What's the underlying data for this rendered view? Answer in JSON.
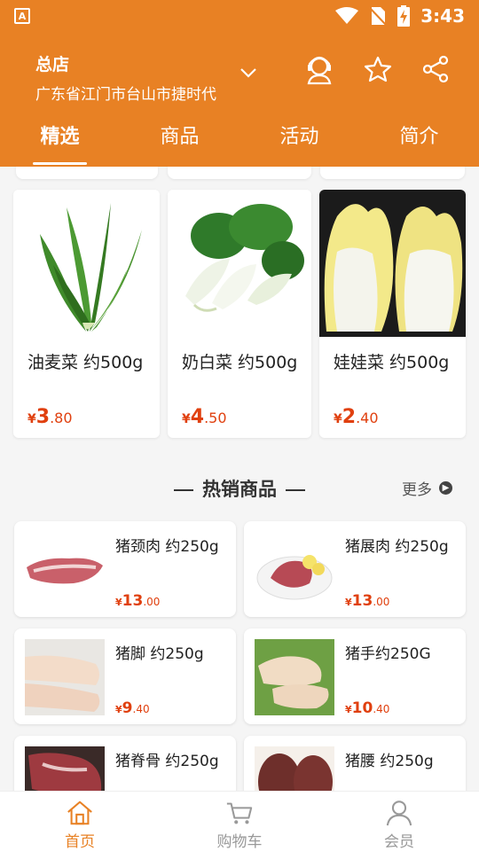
{
  "status_bar": {
    "time": "3:43",
    "left_icon": "A"
  },
  "header": {
    "store_name": "总店",
    "address": "广东省江门市台山市捷时代",
    "icons": [
      "chevron-down-icon",
      "customer-service-icon",
      "star-icon",
      "share-icon"
    ]
  },
  "tabs": [
    {
      "label": "精选",
      "active": true
    },
    {
      "label": "商品",
      "active": false
    },
    {
      "label": "活动",
      "active": false
    },
    {
      "label": "简介",
      "active": false
    }
  ],
  "veg_cards": [
    {
      "name": "油麦菜 约500g",
      "price_int": "3",
      "price_dec": ".80",
      "currency": "¥"
    },
    {
      "name": "奶白菜 约500g",
      "price_int": "4",
      "price_dec": ".50",
      "currency": "¥"
    },
    {
      "name": "娃娃菜 约500g",
      "price_int": "2",
      "price_dec": ".40",
      "currency": "¥"
    }
  ],
  "hot_section": {
    "title": "热销商品",
    "more": "更多"
  },
  "meat_cards": [
    {
      "name": "猪颈肉 约250g",
      "currency": "¥",
      "price_int": "13",
      "price_dec": ".00"
    },
    {
      "name": "猪展肉 约250g",
      "currency": "¥",
      "price_int": "13",
      "price_dec": ".00"
    },
    {
      "name": "猪脚 约250g",
      "currency": "¥",
      "price_int": "9",
      "price_dec": ".40"
    },
    {
      "name": "猪手约250G",
      "currency": "¥",
      "price_int": "10",
      "price_dec": ".40"
    },
    {
      "name": "猪脊骨 约250g",
      "currency": "¥",
      "price_int": "",
      "price_dec": ""
    },
    {
      "name": "猪腰 约250g",
      "currency": "¥",
      "price_int": "",
      "price_dec": ""
    }
  ],
  "bottom_nav": [
    {
      "label": "首页",
      "icon": "home-icon",
      "active": true
    },
    {
      "label": "购物车",
      "icon": "cart-icon",
      "active": false
    },
    {
      "label": "会员",
      "icon": "user-icon",
      "active": false
    }
  ],
  "colors": {
    "brand": "#e88124",
    "price": "#e0400f"
  }
}
